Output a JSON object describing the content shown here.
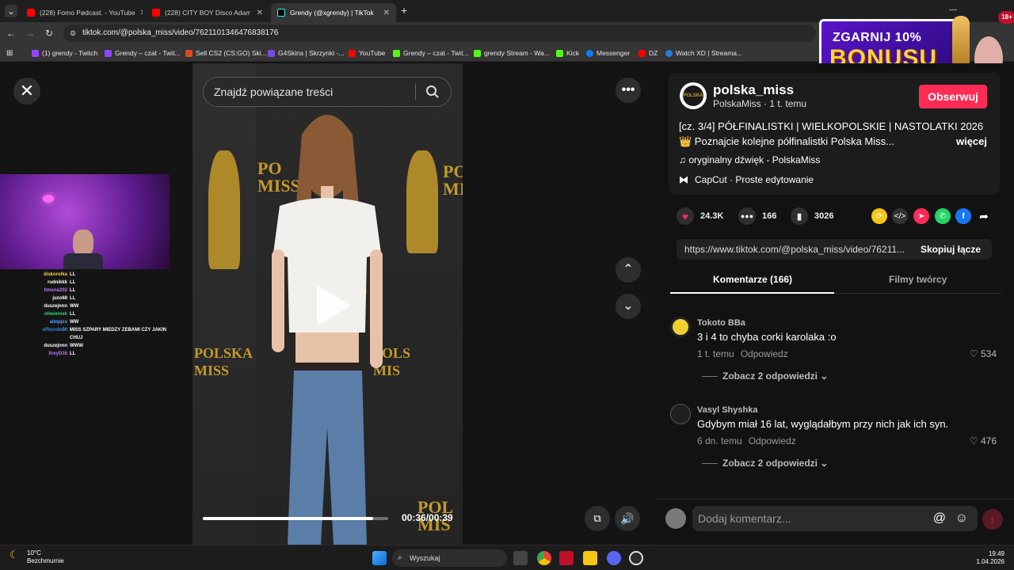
{
  "browser": {
    "tabs": [
      {
        "label": "(228) Fomo Pødcast. - YouTube",
        "color": "#ff0000"
      },
      {
        "label": "(228) CITY BOY Disco Adamus",
        "color": "#ff0000"
      },
      {
        "label": "Grendy (@xgrendy) | TikTok",
        "color": "#000000"
      }
    ],
    "new_tab": "+",
    "url": "tiktok.com/@polska_miss/video/7621101346476838176",
    "bookmarks": [
      {
        "label": "(1) grendy - Twitch",
        "color": "#9146ff"
      },
      {
        "label": "Grendy – czat - Twit...",
        "color": "#9146ff"
      },
      {
        "label": "Sell CS2 (CS:GO) Ski...",
        "color": "#e04a1a"
      },
      {
        "label": "G4Skins | Skrzynki -...",
        "color": "#7a4ae0"
      },
      {
        "label": "YouTube",
        "color": "#ff0000"
      },
      {
        "label": "Grendy – czat - Twit...",
        "color": "#53fc18"
      },
      {
        "label": "grendy Stream - Wa...",
        "color": "#53fc18"
      },
      {
        "label": "Kick",
        "color": "#53fc18"
      },
      {
        "label": "Messenger",
        "color": "#0a7cff"
      },
      {
        "label": "DZ",
        "color": "#ff0000"
      },
      {
        "label": "Watch XD | Streama...",
        "color": "#2a7ae0"
      }
    ]
  },
  "ad": {
    "line1": "ZGARNIJ 10%",
    "line2": "BONUSU",
    "age": "18+"
  },
  "video": {
    "search_placeholder": "Znajdź powiązane treści",
    "time": "00:36/00:39",
    "progress": 0.92,
    "brand": "POLSKA MISS"
  },
  "stream_chat": [
    {
      "user": "diskorolka",
      "msg": "LL",
      "color": "#ffd23a"
    },
    {
      "user": "rudnikkk",
      "msg": "LL",
      "color": "#ffffff"
    },
    {
      "user": "llmona202",
      "msg": "LL",
      "color": "#c07aff"
    },
    {
      "user": "juzo68",
      "msg": "LL",
      "color": "#ffffff"
    },
    {
      "user": "duszejnnn",
      "msg": "WW",
      "color": "#ffffff"
    },
    {
      "user": "oliwiereek",
      "msg": "LL",
      "color": "#3ad07a"
    },
    {
      "user": "aleqqss",
      "msg": "WW",
      "color": "#5aa0ff"
    },
    {
      "user": "xPiccolo96",
      "msg": "MISS SZPARY MIEDZY ZEBAMI CZY JAKIN CHUJ",
      "color": "#3a8aff"
    },
    {
      "user": "duszejnnn",
      "msg": "WWW",
      "color": "#ffffff"
    },
    {
      "user": "XreyD16",
      "msg": "LL",
      "color": "#c07aff"
    }
  ],
  "post": {
    "username": "polska_miss",
    "subname": "PolskaMiss · 1 t. temu",
    "follow": "Obserwuj",
    "desc1": "[cz. 3/4] PÓŁFINALISTKI | WIELKOPOLSKIE | NASTOLATKI 2026",
    "desc2": "👑 Poznajcie kolejne półfinalistki Polska Miss...",
    "more": "więcej",
    "music": "♫  oryginalny dźwięk - PolskaMiss",
    "capcut": "CapCut · Proste edytowanie",
    "likes": "24.3K",
    "comments_count": "166",
    "saves": "3026",
    "link": "https://www.tiktok.com/@polska_miss/video/76211...",
    "copy": "Skopiuj łącze",
    "tab_comments": "Komentarze (166)",
    "tab_creator": "Filmy twórcy"
  },
  "comments": [
    {
      "name": "Tokoto BBa",
      "text": "3 i 4 to chyba corki karolaka :o",
      "time": "1 t. temu",
      "reply": "Odpowiedz",
      "likes": "534",
      "replies": "Zobacz 2 odpowiedzi"
    },
    {
      "name": "Vasyl Shyshka",
      "text": "Gdybym miał 16 lat, wyglądałbym przy nich jak ich syn.",
      "time": "6 dn. temu",
      "reply": "Odpowiedz",
      "likes": "476",
      "replies": "Zobacz 2 odpowiedzi"
    }
  ],
  "comment_input": {
    "placeholder": "Dodaj komentarz..."
  },
  "taskbar": {
    "temp": "10°C",
    "weather": "Bezchmurnie",
    "search": "Wyszukaj",
    "time": "19:49",
    "date": "1.04.2026"
  }
}
